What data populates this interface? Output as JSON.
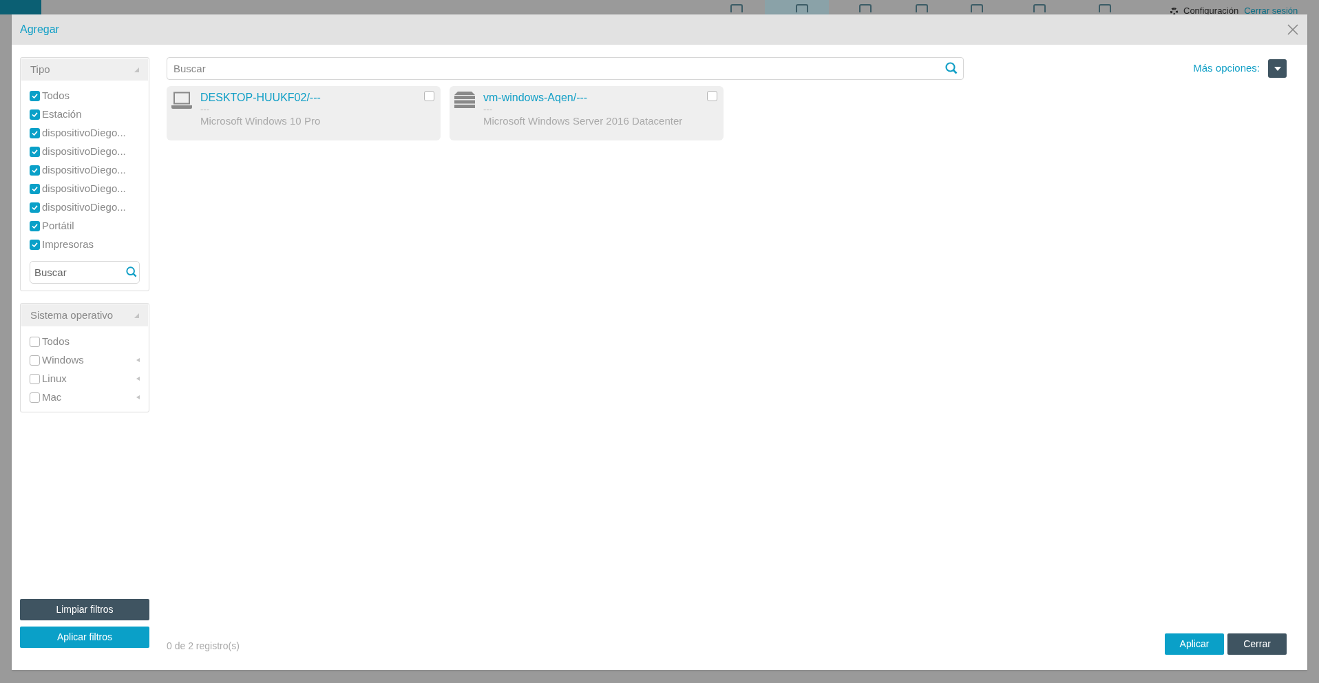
{
  "app_bar": {
    "links": [
      "Configuración",
      "Cerrar sesión"
    ]
  },
  "dialog": {
    "title": "Agregar",
    "filters": [
      {
        "title": "Tipo",
        "expanded": true,
        "search": {
          "placeholder": "Buscar"
        },
        "items": [
          {
            "label": "Todos",
            "checked": true,
            "expandable": false
          },
          {
            "label": "Estación",
            "checked": true,
            "expandable": false
          },
          {
            "label": "dispositivoDiego...",
            "checked": true,
            "expandable": false
          },
          {
            "label": "dispositivoDiego...",
            "checked": true,
            "expandable": false
          },
          {
            "label": "dispositivoDiego...",
            "checked": true,
            "expandable": false
          },
          {
            "label": "dispositivoDiego...",
            "checked": true,
            "expandable": false
          },
          {
            "label": "dispositivoDiego...",
            "checked": true,
            "expandable": false
          },
          {
            "label": "Portátil",
            "checked": true,
            "expandable": false
          },
          {
            "label": "Impresoras",
            "checked": true,
            "expandable": false
          }
        ]
      },
      {
        "title": "Sistema operativo",
        "expanded": true,
        "items": [
          {
            "label": "Todos",
            "checked": false,
            "expandable": false
          },
          {
            "label": "Windows",
            "checked": false,
            "expandable": true
          },
          {
            "label": "Linux",
            "checked": false,
            "expandable": true
          },
          {
            "label": "Mac",
            "checked": false,
            "expandable": true
          }
        ]
      }
    ],
    "filter_buttons": [
      {
        "label": "Limpiar filtros",
        "kind": "secondary"
      },
      {
        "label": "Aplicar filtros",
        "kind": "primary"
      }
    ],
    "search": {
      "placeholder": "Buscar"
    },
    "more_options": "Más opciones:",
    "devices": [
      {
        "kind": "laptop",
        "name": "DESKTOP-HUUKF02/---",
        "subtitle": "---",
        "os": "Microsoft Windows 10 Pro",
        "checked": false
      },
      {
        "kind": "server",
        "name": "vm-windows-Aqen/---",
        "subtitle": "---",
        "os": "Microsoft Windows Server 2016 Datacenter",
        "checked": false
      }
    ],
    "record_count": "0 de 2 registro(s)",
    "buttons": [
      {
        "label": "Aplicar",
        "kind": "primary"
      },
      {
        "label": "Cerrar",
        "kind": "secondary"
      }
    ]
  }
}
